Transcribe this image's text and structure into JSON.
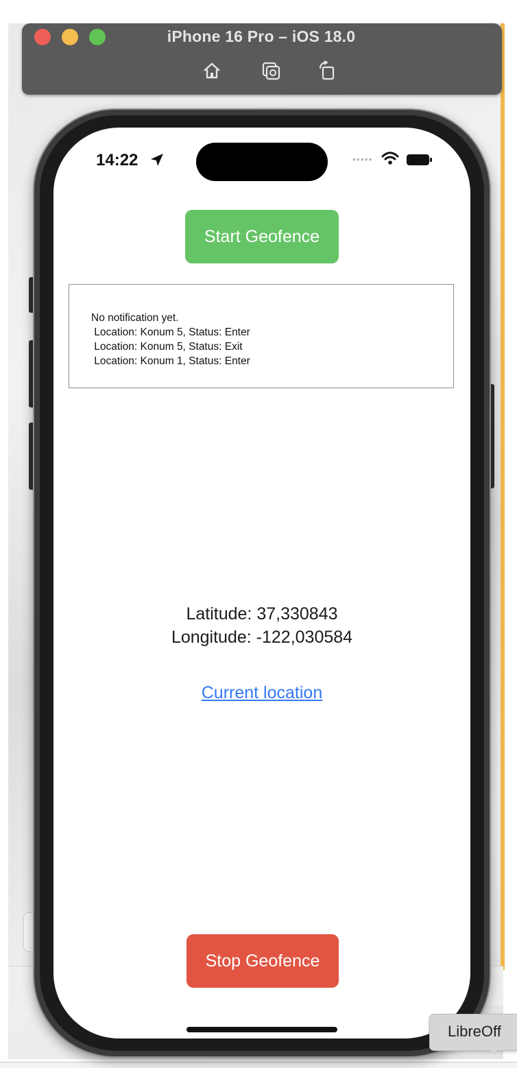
{
  "simulator": {
    "title": "iPhone 16 Pro – iOS 18.0",
    "toolbar_icons": [
      "home-icon",
      "screenshot-icon",
      "rotate-icon"
    ]
  },
  "status_bar": {
    "time": "14:22",
    "icons": [
      "location-arrow-icon",
      "cellular-dots",
      "wifi-icon",
      "battery-icon"
    ]
  },
  "app": {
    "start_button": "Start Geofence",
    "notifications": [
      "No notification yet.",
      " Location: Konum 5, Status: Enter",
      " Location: Konum 5, Status: Exit",
      " Location: Konum 1, Status: Enter"
    ],
    "latitude": "Latitude: 37,330843",
    "longitude": "Longitude: -122,030584",
    "current_location_link": "Current location",
    "stop_button": "Stop Geofence"
  },
  "tooltip": {
    "text": "LibreOff"
  },
  "colors": {
    "start_button": "#65c466",
    "stop_button": "#e25543",
    "link": "#3478f6",
    "titlebar": "#5a5a5a"
  }
}
